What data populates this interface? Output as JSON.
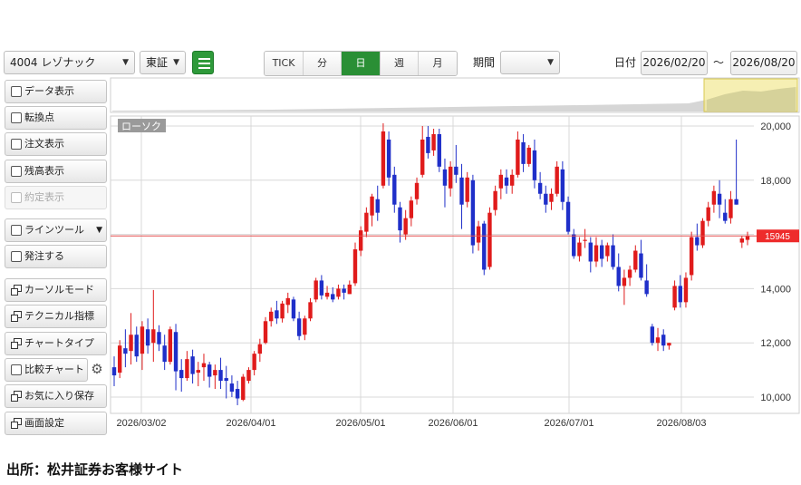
{
  "toolbar": {
    "stock_select": "4004 レゾナック",
    "market_select": "東証",
    "intervals": [
      "TICK",
      "分",
      "日",
      "週",
      "月"
    ],
    "active_interval": "日",
    "period_label": "期間",
    "period_value": "",
    "date_label": "日付",
    "date_from": "2026/02/20",
    "date_sep": "〜",
    "date_to": "2026/08/20"
  },
  "sidebar": {
    "data_display": "データ表示",
    "turning_point": "転換点",
    "order_display": "注文表示",
    "balance_display": "残高表示",
    "executed_display": "約定表示",
    "line_tool": "ラインツール",
    "place_order": "発注する",
    "cursor_mode": "カーソルモード",
    "technical": "テクニカル指標",
    "chart_type": "チャートタイプ",
    "compare_chart": "比較チャート",
    "save_favorite": "お気に入り保存",
    "screen_settings": "画面設定"
  },
  "chart_label": "ローソク",
  "current_price": "15945",
  "source": "出所：松井証券お客様サイト",
  "colors": {
    "up": "#e01b1b",
    "down": "#1f2fc9",
    "accent": "#2a8f35",
    "price_line": "#e55050"
  },
  "chart_data": {
    "type": "candlestick",
    "y_ticks": [
      "20,000",
      "18,000",
      "16,000",
      "14,000",
      "12,000",
      "10,000"
    ],
    "y_tick_values": [
      20000,
      18000,
      16000,
      14000,
      12000,
      10000
    ],
    "ylim": [
      9600,
      20400
    ],
    "x_ticks": [
      "2026/03/02",
      "2026/04/01",
      "2026/05/01",
      "2026/06/01",
      "2026/07/01",
      "2026/08/03"
    ],
    "current_price": 15945,
    "candles": [
      [
        11100,
        11500,
        10400,
        10800
      ],
      [
        10900,
        12100,
        10700,
        11900
      ],
      [
        11800,
        12500,
        11100,
        11600
      ],
      [
        11700,
        13100,
        11200,
        12300
      ],
      [
        12300,
        12600,
        11300,
        11500
      ],
      [
        11600,
        12800,
        11000,
        12600
      ],
      [
        12500,
        12900,
        11600,
        11900
      ],
      [
        12000,
        13950,
        11300,
        12500
      ],
      [
        12400,
        12650,
        11700,
        11950
      ],
      [
        11900,
        12300,
        11000,
        11300
      ],
      [
        11300,
        12600,
        11200,
        12500
      ],
      [
        12400,
        12700,
        10250,
        10950
      ],
      [
        11000,
        11400,
        10200,
        10700
      ],
      [
        10700,
        11700,
        10600,
        11400
      ],
      [
        11500,
        11750,
        10500,
        10850
      ],
      [
        10900,
        11300,
        10400,
        11000
      ],
      [
        11100,
        11600,
        10600,
        11250
      ],
      [
        11200,
        11300,
        10350,
        10750
      ],
      [
        10800,
        11200,
        10300,
        11000
      ],
      [
        11000,
        11450,
        10300,
        10600
      ],
      [
        10700,
        11150,
        9950,
        10600
      ],
      [
        10500,
        10800,
        10000,
        10200
      ],
      [
        10300,
        10600,
        9700,
        9950
      ],
      [
        9900,
        10850,
        9850,
        10750
      ],
      [
        10600,
        11100,
        10500,
        11000
      ],
      [
        11000,
        11700,
        10800,
        11600
      ],
      [
        11600,
        12150,
        11300,
        11950
      ],
      [
        12000,
        12950,
        11950,
        12800
      ],
      [
        12800,
        13300,
        12600,
        13150
      ],
      [
        13200,
        13550,
        12700,
        12900
      ],
      [
        12900,
        13550,
        12750,
        13450
      ],
      [
        13400,
        13850,
        13100,
        13650
      ],
      [
        13600,
        13700,
        12800,
        12900
      ],
      [
        12900,
        13150,
        12100,
        12250
      ],
      [
        12300,
        13000,
        12100,
        12900
      ],
      [
        12900,
        13650,
        12800,
        13500
      ],
      [
        13600,
        14400,
        13500,
        14300
      ],
      [
        14300,
        14500,
        13600,
        13750
      ],
      [
        13700,
        14100,
        13600,
        13850
      ],
      [
        13800,
        14050,
        13500,
        13600
      ],
      [
        13700,
        14150,
        13600,
        14000
      ],
      [
        14000,
        14150,
        13600,
        13850
      ],
      [
        13800,
        14300,
        13800,
        14150
      ],
      [
        14200,
        15700,
        14100,
        15450
      ],
      [
        15400,
        16300,
        15200,
        16150
      ],
      [
        16100,
        17000,
        15900,
        16800
      ],
      [
        16700,
        17500,
        16300,
        17400
      ],
      [
        17300,
        17800,
        16500,
        16800
      ],
      [
        17800,
        20100,
        17700,
        19800
      ],
      [
        19500,
        19800,
        17800,
        18100
      ],
      [
        18200,
        18500,
        16800,
        17100
      ],
      [
        17000,
        17200,
        15700,
        16150
      ],
      [
        16000,
        16900,
        15800,
        16600
      ],
      [
        16600,
        17400,
        16300,
        17250
      ],
      [
        17300,
        18100,
        17100,
        17900
      ],
      [
        18200,
        20000,
        18100,
        19500
      ],
      [
        19600,
        20000,
        18800,
        19000
      ],
      [
        19100,
        19900,
        18900,
        19700
      ],
      [
        19700,
        19900,
        18300,
        18500
      ],
      [
        18400,
        18800,
        17000,
        17800
      ],
      [
        17700,
        18700,
        17400,
        18500
      ],
      [
        18500,
        19300,
        17900,
        18200
      ],
      [
        18100,
        18600,
        16200,
        17100
      ],
      [
        17200,
        18300,
        17000,
        18100
      ],
      [
        18000,
        18200,
        15300,
        15600
      ],
      [
        15700,
        16500,
        15400,
        16300
      ],
      [
        16400,
        16500,
        14500,
        14700
      ],
      [
        14800,
        17000,
        14700,
        16800
      ],
      [
        16900,
        17800,
        16700,
        17600
      ],
      [
        17700,
        18400,
        17300,
        18200
      ],
      [
        18100,
        18400,
        17500,
        17800
      ],
      [
        17800,
        18400,
        17500,
        18200
      ],
      [
        18200,
        19800,
        18100,
        19500
      ],
      [
        19400,
        19700,
        18300,
        18600
      ],
      [
        18600,
        19300,
        18500,
        19200
      ],
      [
        19100,
        19500,
        17700,
        18000
      ],
      [
        17900,
        18300,
        17300,
        17500
      ],
      [
        17500,
        17800,
        16800,
        17100
      ],
      [
        17200,
        17700,
        16900,
        17500
      ],
      [
        17500,
        18700,
        17400,
        18500
      ],
      [
        18400,
        18700,
        16900,
        17200
      ],
      [
        17200,
        17400,
        16000,
        16100
      ],
      [
        16000,
        16200,
        15100,
        15200
      ],
      [
        15200,
        15900,
        15000,
        15700
      ],
      [
        15800,
        16200,
        15500,
        15800
      ],
      [
        15700,
        15900,
        14600,
        15000
      ],
      [
        15000,
        15900,
        14800,
        15600
      ],
      [
        15600,
        15800,
        14800,
        15100
      ],
      [
        15200,
        15700,
        15000,
        15600
      ],
      [
        15600,
        16000,
        14700,
        14800
      ],
      [
        14800,
        15300,
        13900,
        14100
      ],
      [
        14100,
        14700,
        13400,
        14400
      ],
      [
        14400,
        14850,
        14100,
        14700
      ],
      [
        14700,
        15600,
        14600,
        15400
      ],
      [
        15300,
        15800,
        14300,
        14400
      ],
      [
        14300,
        14900,
        13700,
        13800
      ],
      [
        12600,
        12700,
        11900,
        12000
      ],
      [
        12000,
        12550,
        11700,
        12200
      ],
      [
        12300,
        12500,
        11700,
        11900
      ],
      [
        11900,
        12000,
        11750,
        12000
      ],
      [
        13300,
        14300,
        13200,
        14100
      ],
      [
        14100,
        14500,
        13300,
        13500
      ],
      [
        13500,
        14600,
        13300,
        14400
      ],
      [
        14500,
        16100,
        14300,
        15900
      ],
      [
        15900,
        16400,
        15400,
        15600
      ],
      [
        15600,
        16600,
        15500,
        16500
      ],
      [
        16500,
        17200,
        16300,
        17000
      ],
      [
        17100,
        17800,
        16800,
        17600
      ],
      [
        17500,
        18000,
        16600,
        17100
      ],
      [
        16800,
        17300,
        16400,
        16500
      ],
      [
        16600,
        17600,
        16400,
        17300
      ],
      [
        17300,
        19500,
        17100,
        17100
      ],
      [
        15700,
        15950,
        15500,
        15850
      ],
      [
        15800,
        16100,
        15600,
        15945
      ]
    ]
  }
}
